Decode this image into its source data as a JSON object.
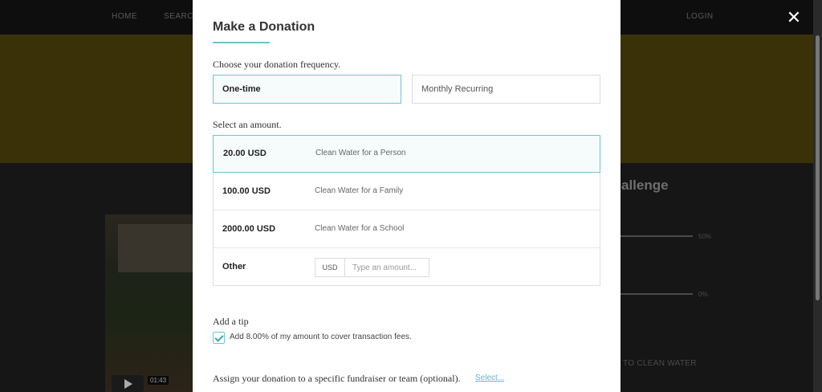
{
  "background": {
    "nav_items": [
      "HOME",
      "SEARCH",
      "LOGIN"
    ],
    "challenge_heading": "allenge",
    "progress_labels": [
      "50%",
      "0%"
    ],
    "clean_water_text": "TO CLEAN WATER",
    "video_time": "01:43"
  },
  "close_icon": "close-icon",
  "modal": {
    "title": "Make a Donation",
    "frequency": {
      "label": "Choose your donation frequency.",
      "options": [
        "One-time",
        "Monthly Recurring"
      ],
      "selected": "One-time"
    },
    "amounts": {
      "label": "Select an amount.",
      "rows": [
        {
          "amount": "20.00 USD",
          "description": "Clean Water for a Person"
        },
        {
          "amount": "100.00 USD",
          "description": "Clean Water for a Family"
        },
        {
          "amount": "2000.00 USD",
          "description": "Clean Water for a School"
        }
      ],
      "selected": "20.00 USD",
      "other": {
        "label": "Other",
        "currency": "USD",
        "placeholder": "Type an amount..."
      }
    },
    "tip": {
      "label": "Add a tip",
      "checked": true,
      "text": "Add 8.00% of my amount to cover transaction fees."
    },
    "assign": {
      "label": "Assign your donation to a specific fundraiser or team (optional).",
      "link": "Select..."
    }
  },
  "colors": {
    "accent": "#6cc6cf",
    "link": "#6ab0dd",
    "banner": "#3b3109"
  }
}
